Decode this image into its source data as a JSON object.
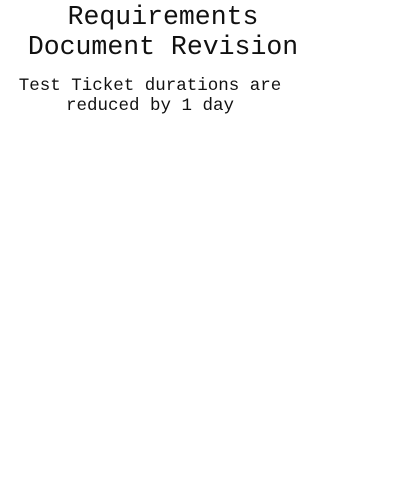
{
  "dialog": {
    "title": "Requirements\nDocument Revision",
    "message": "Test Ticket durations are\nreduced by 1 day"
  }
}
